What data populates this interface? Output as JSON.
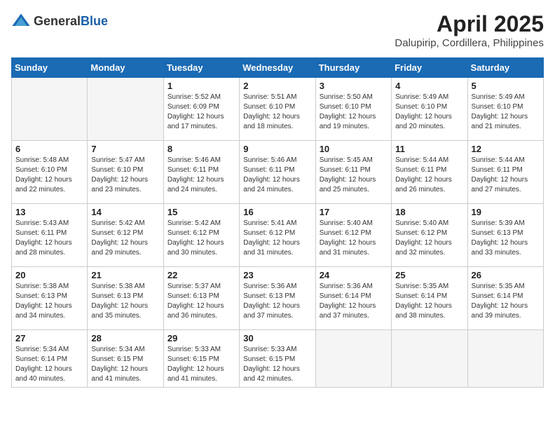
{
  "header": {
    "logo_general": "General",
    "logo_blue": "Blue",
    "month_title": "April 2025",
    "location": "Dalupirip, Cordillera, Philippines"
  },
  "days_of_week": [
    "Sunday",
    "Monday",
    "Tuesday",
    "Wednesday",
    "Thursday",
    "Friday",
    "Saturday"
  ],
  "weeks": [
    [
      {
        "day": "",
        "sunrise": "",
        "sunset": "",
        "daylight": "",
        "empty": true
      },
      {
        "day": "",
        "sunrise": "",
        "sunset": "",
        "daylight": "",
        "empty": true
      },
      {
        "day": "1",
        "sunrise": "Sunrise: 5:52 AM",
        "sunset": "Sunset: 6:09 PM",
        "daylight": "Daylight: 12 hours and 17 minutes.",
        "empty": false
      },
      {
        "day": "2",
        "sunrise": "Sunrise: 5:51 AM",
        "sunset": "Sunset: 6:10 PM",
        "daylight": "Daylight: 12 hours and 18 minutes.",
        "empty": false
      },
      {
        "day": "3",
        "sunrise": "Sunrise: 5:50 AM",
        "sunset": "Sunset: 6:10 PM",
        "daylight": "Daylight: 12 hours and 19 minutes.",
        "empty": false
      },
      {
        "day": "4",
        "sunrise": "Sunrise: 5:49 AM",
        "sunset": "Sunset: 6:10 PM",
        "daylight": "Daylight: 12 hours and 20 minutes.",
        "empty": false
      },
      {
        "day": "5",
        "sunrise": "Sunrise: 5:49 AM",
        "sunset": "Sunset: 6:10 PM",
        "daylight": "Daylight: 12 hours and 21 minutes.",
        "empty": false
      }
    ],
    [
      {
        "day": "6",
        "sunrise": "Sunrise: 5:48 AM",
        "sunset": "Sunset: 6:10 PM",
        "daylight": "Daylight: 12 hours and 22 minutes.",
        "empty": false
      },
      {
        "day": "7",
        "sunrise": "Sunrise: 5:47 AM",
        "sunset": "Sunset: 6:10 PM",
        "daylight": "Daylight: 12 hours and 23 minutes.",
        "empty": false
      },
      {
        "day": "8",
        "sunrise": "Sunrise: 5:46 AM",
        "sunset": "Sunset: 6:11 PM",
        "daylight": "Daylight: 12 hours and 24 minutes.",
        "empty": false
      },
      {
        "day": "9",
        "sunrise": "Sunrise: 5:46 AM",
        "sunset": "Sunset: 6:11 PM",
        "daylight": "Daylight: 12 hours and 24 minutes.",
        "empty": false
      },
      {
        "day": "10",
        "sunrise": "Sunrise: 5:45 AM",
        "sunset": "Sunset: 6:11 PM",
        "daylight": "Daylight: 12 hours and 25 minutes.",
        "empty": false
      },
      {
        "day": "11",
        "sunrise": "Sunrise: 5:44 AM",
        "sunset": "Sunset: 6:11 PM",
        "daylight": "Daylight: 12 hours and 26 minutes.",
        "empty": false
      },
      {
        "day": "12",
        "sunrise": "Sunrise: 5:44 AM",
        "sunset": "Sunset: 6:11 PM",
        "daylight": "Daylight: 12 hours and 27 minutes.",
        "empty": false
      }
    ],
    [
      {
        "day": "13",
        "sunrise": "Sunrise: 5:43 AM",
        "sunset": "Sunset: 6:11 PM",
        "daylight": "Daylight: 12 hours and 28 minutes.",
        "empty": false
      },
      {
        "day": "14",
        "sunrise": "Sunrise: 5:42 AM",
        "sunset": "Sunset: 6:12 PM",
        "daylight": "Daylight: 12 hours and 29 minutes.",
        "empty": false
      },
      {
        "day": "15",
        "sunrise": "Sunrise: 5:42 AM",
        "sunset": "Sunset: 6:12 PM",
        "daylight": "Daylight: 12 hours and 30 minutes.",
        "empty": false
      },
      {
        "day": "16",
        "sunrise": "Sunrise: 5:41 AM",
        "sunset": "Sunset: 6:12 PM",
        "daylight": "Daylight: 12 hours and 31 minutes.",
        "empty": false
      },
      {
        "day": "17",
        "sunrise": "Sunrise: 5:40 AM",
        "sunset": "Sunset: 6:12 PM",
        "daylight": "Daylight: 12 hours and 31 minutes.",
        "empty": false
      },
      {
        "day": "18",
        "sunrise": "Sunrise: 5:40 AM",
        "sunset": "Sunset: 6:12 PM",
        "daylight": "Daylight: 12 hours and 32 minutes.",
        "empty": false
      },
      {
        "day": "19",
        "sunrise": "Sunrise: 5:39 AM",
        "sunset": "Sunset: 6:13 PM",
        "daylight": "Daylight: 12 hours and 33 minutes.",
        "empty": false
      }
    ],
    [
      {
        "day": "20",
        "sunrise": "Sunrise: 5:38 AM",
        "sunset": "Sunset: 6:13 PM",
        "daylight": "Daylight: 12 hours and 34 minutes.",
        "empty": false
      },
      {
        "day": "21",
        "sunrise": "Sunrise: 5:38 AM",
        "sunset": "Sunset: 6:13 PM",
        "daylight": "Daylight: 12 hours and 35 minutes.",
        "empty": false
      },
      {
        "day": "22",
        "sunrise": "Sunrise: 5:37 AM",
        "sunset": "Sunset: 6:13 PM",
        "daylight": "Daylight: 12 hours and 36 minutes.",
        "empty": false
      },
      {
        "day": "23",
        "sunrise": "Sunrise: 5:36 AM",
        "sunset": "Sunset: 6:13 PM",
        "daylight": "Daylight: 12 hours and 37 minutes.",
        "empty": false
      },
      {
        "day": "24",
        "sunrise": "Sunrise: 5:36 AM",
        "sunset": "Sunset: 6:14 PM",
        "daylight": "Daylight: 12 hours and 37 minutes.",
        "empty": false
      },
      {
        "day": "25",
        "sunrise": "Sunrise: 5:35 AM",
        "sunset": "Sunset: 6:14 PM",
        "daylight": "Daylight: 12 hours and 38 minutes.",
        "empty": false
      },
      {
        "day": "26",
        "sunrise": "Sunrise: 5:35 AM",
        "sunset": "Sunset: 6:14 PM",
        "daylight": "Daylight: 12 hours and 39 minutes.",
        "empty": false
      }
    ],
    [
      {
        "day": "27",
        "sunrise": "Sunrise: 5:34 AM",
        "sunset": "Sunset: 6:14 PM",
        "daylight": "Daylight: 12 hours and 40 minutes.",
        "empty": false
      },
      {
        "day": "28",
        "sunrise": "Sunrise: 5:34 AM",
        "sunset": "Sunset: 6:15 PM",
        "daylight": "Daylight: 12 hours and 41 minutes.",
        "empty": false
      },
      {
        "day": "29",
        "sunrise": "Sunrise: 5:33 AM",
        "sunset": "Sunset: 6:15 PM",
        "daylight": "Daylight: 12 hours and 41 minutes.",
        "empty": false
      },
      {
        "day": "30",
        "sunrise": "Sunrise: 5:33 AM",
        "sunset": "Sunset: 6:15 PM",
        "daylight": "Daylight: 12 hours and 42 minutes.",
        "empty": false
      },
      {
        "day": "",
        "sunrise": "",
        "sunset": "",
        "daylight": "",
        "empty": true
      },
      {
        "day": "",
        "sunrise": "",
        "sunset": "",
        "daylight": "",
        "empty": true
      },
      {
        "day": "",
        "sunrise": "",
        "sunset": "",
        "daylight": "",
        "empty": true
      }
    ]
  ]
}
